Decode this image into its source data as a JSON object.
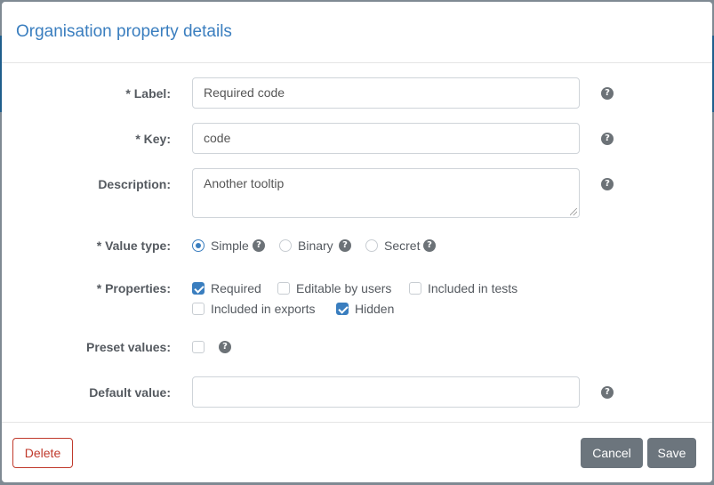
{
  "modal": {
    "title": "Organisation property details"
  },
  "form": {
    "label": {
      "caption": "* Label:",
      "value": "Required code"
    },
    "key": {
      "caption": "* Key:",
      "value": "code"
    },
    "description": {
      "caption": "Description:",
      "value": "Another tooltip"
    },
    "value_type": {
      "caption": "* Value type:",
      "options": [
        {
          "label": "Simple",
          "selected": true
        },
        {
          "label": "Binary",
          "selected": false
        },
        {
          "label": "Secret",
          "selected": false
        }
      ]
    },
    "properties": {
      "caption": "* Properties:",
      "options": [
        {
          "label": "Required",
          "checked": true
        },
        {
          "label": "Editable by users",
          "checked": false
        },
        {
          "label": "Included in tests",
          "checked": false
        },
        {
          "label": "Included in exports",
          "checked": false
        },
        {
          "label": "Hidden",
          "checked": true
        }
      ]
    },
    "preset_values": {
      "caption": "Preset values:",
      "checked": false
    },
    "default_value": {
      "caption": "Default value:",
      "value": ""
    },
    "help_icon": "?"
  },
  "footer": {
    "delete_label": "Delete",
    "cancel_label": "Cancel",
    "save_label": "Save"
  },
  "colors": {
    "title": "#3a7ebf",
    "accent": "#3a7ebf",
    "delete": "#c0392b",
    "secondary_button": "#6c757d"
  }
}
